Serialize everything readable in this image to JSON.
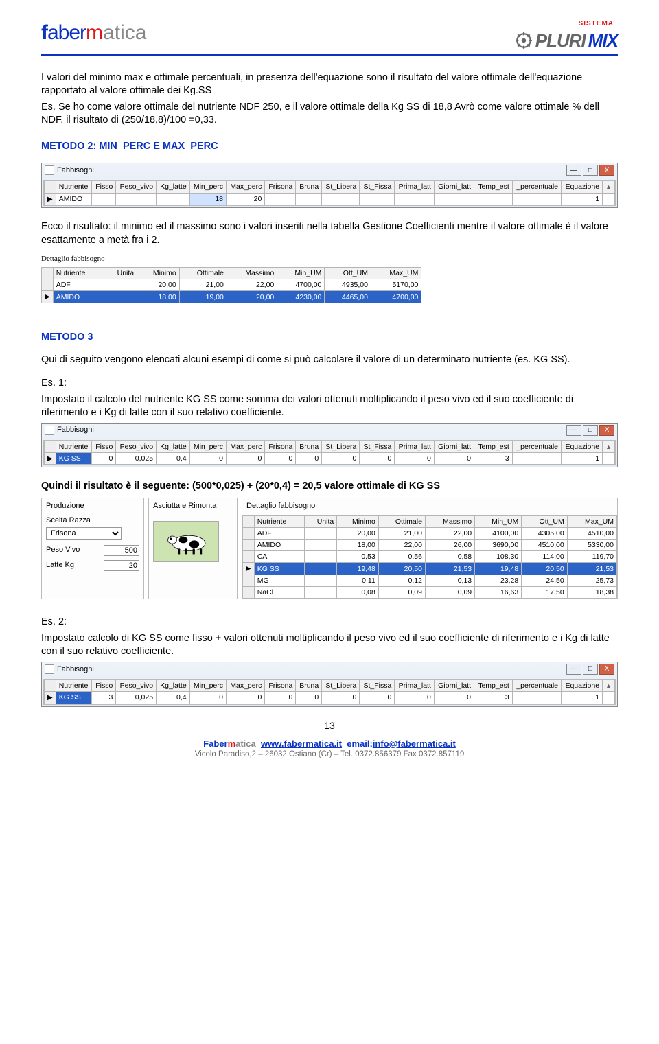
{
  "brand": {
    "left_f": "f",
    "left_aber": "aber",
    "left_m": "m",
    "left_atica": "atica",
    "right_top": "SISTEMA",
    "right_pluri": "PLURI",
    "right_mix": "MIX"
  },
  "para1_a": "I valori del minimo max e ottimale percentuali, in presenza dell'equazione sono il risultato del valore ottimale dell'equazione rapportato al valore ottimale dei Kg.SS",
  "para1_b": "Es. Se ho come valore ottimale del nutriente NDF 250, e il valore ottimale della Kg SS di 18,8 Avrò come valore ottimale % dell NDF, il risultato di (250/18,8)/100 =0,33.",
  "heading2": "METODO 2: MIN_PERC E MAX_PERC",
  "win_fabbisogni": "Fabbisogni",
  "win_btns": {
    "min": "—",
    "max": "□",
    "close": "X"
  },
  "grid1": {
    "headers": [
      "Nutriente",
      "Fisso",
      "Peso_vivo",
      "Kg_latte",
      "Min_perc",
      "Max_perc",
      "Frisona",
      "Bruna",
      "St_Libera",
      "St_Fissa",
      "Prima_latt",
      "Giorni_latt",
      "Temp_est",
      "_percentuale",
      "Equazione"
    ],
    "row": {
      "nutriente": "AMIDO",
      "min_perc": "18",
      "max_perc": "20",
      "equazione": "1"
    }
  },
  "para2": "Ecco il risultato: il minimo ed il massimo sono i valori inseriti nella tabella Gestione Coefficienti mentre il valore ottimale è il valore esattamente a metà fra i 2.",
  "dettaglio_title": "Dettaglio fabbisogno",
  "grid2": {
    "headers": [
      "Nutriente",
      "Unita",
      "Minimo",
      "Ottimale",
      "Massimo",
      "Min_UM",
      "Ott_UM",
      "Max_UM"
    ],
    "rows": [
      {
        "n": "ADF",
        "u": "",
        "min": "20,00",
        "ott": "21,00",
        "max": "22,00",
        "minu": "4700,00",
        "ottu": "4935,00",
        "maxu": "5170,00"
      },
      {
        "n": "AMIDO",
        "u": "",
        "min": "18,00",
        "ott": "19,00",
        "max": "20,00",
        "minu": "4230,00",
        "ottu": "4465,00",
        "maxu": "4700,00",
        "sel": true
      }
    ]
  },
  "heading3": "METODO 3",
  "para3": "Qui di seguito vengono elencati alcuni esempi di come si può calcolare il valore di un determinato nutriente (es. KG SS).",
  "es1_label": "Es. 1:",
  "es1_text": "Impostato il calcolo del nutriente KG SS come somma dei valori ottenuti moltiplicando il peso vivo ed il suo coefficiente di riferimento e i Kg di latte con il suo relativo coefficiente.",
  "grid3": {
    "headers": [
      "Nutriente",
      "Fisso",
      "Peso_vivo",
      "Kg_latte",
      "Min_perc",
      "Max_perc",
      "Frisona",
      "Bruna",
      "St_Libera",
      "St_Fissa",
      "Prima_latt",
      "Giorni_latt",
      "Temp_est",
      "_percentuale",
      "Equazione"
    ],
    "row": {
      "nutriente": "KG SS",
      "fisso": "0",
      "peso": "0,025",
      "kg": "0,4",
      "min": "0",
      "max": "0",
      "fri": "0",
      "bru": "0",
      "stl": "0",
      "stf": "0",
      "pri": "0",
      "gio": "0",
      "tmp": "3",
      "perc": "",
      "eq": "1"
    }
  },
  "para4": "Quindi il risultato è il seguente: (500*0,025) + (20*0,4) = 20,5 valore ottimale di KG SS",
  "prod": {
    "title_prod": "Produzione",
    "title_asc": "Asciutta e Rimonta",
    "scelta_label": "Scelta Razza",
    "scelta_value": "Frisona",
    "peso_label": "Peso Vivo",
    "peso_value": "500",
    "latte_label": "Latte Kg",
    "latte_value": "20"
  },
  "grid4": {
    "title": "Dettaglio fabbisogno",
    "headers": [
      "Nutriente",
      "Unita",
      "Minimo",
      "Ottimale",
      "Massimo",
      "Min_UM",
      "Ott_UM",
      "Max_UM"
    ],
    "rows": [
      {
        "n": "ADF",
        "u": "",
        "min": "20,00",
        "ott": "21,00",
        "max": "22,00",
        "minu": "4100,00",
        "ottu": "4305,00",
        "maxu": "4510,00"
      },
      {
        "n": "AMIDO",
        "u": "",
        "min": "18,00",
        "ott": "22,00",
        "max": "26,00",
        "minu": "3690,00",
        "ottu": "4510,00",
        "maxu": "5330,00"
      },
      {
        "n": "CA",
        "u": "",
        "min": "0,53",
        "ott": "0,56",
        "max": "0,58",
        "minu": "108,30",
        "ottu": "114,00",
        "maxu": "119,70"
      },
      {
        "n": "KG SS",
        "u": "",
        "min": "19,48",
        "ott": "20,50",
        "max": "21,53",
        "minu": "19,48",
        "ottu": "20,50",
        "maxu": "21,53",
        "sel": true
      },
      {
        "n": "MG",
        "u": "",
        "min": "0,11",
        "ott": "0,12",
        "max": "0,13",
        "minu": "23,28",
        "ottu": "24,50",
        "maxu": "25,73"
      },
      {
        "n": "NaCl",
        "u": "",
        "min": "0,08",
        "ott": "0,09",
        "max": "0,09",
        "minu": "16,63",
        "ottu": "17,50",
        "maxu": "18,38"
      }
    ]
  },
  "es2_label": "Es. 2:",
  "es2_text": "Impostato calcolo di KG SS come fisso + valori ottenuti moltiplicando il peso vivo ed il suo coefficiente di riferimento e i Kg di latte con il suo relativo coefficiente.",
  "grid5": {
    "headers": [
      "Nutriente",
      "Fisso",
      "Peso_vivo",
      "Kg_latte",
      "Min_perc",
      "Max_perc",
      "Frisona",
      "Bruna",
      "St_Libera",
      "St_Fissa",
      "Prima_latt",
      "Giorni_latt",
      "Temp_est",
      "_percentuale",
      "Equazione"
    ],
    "row": {
      "nutriente": "KG SS",
      "fisso": "3",
      "peso": "0,025",
      "kg": "0,4",
      "min": "0",
      "max": "0",
      "fri": "0",
      "bru": "0",
      "stl": "0",
      "stf": "0",
      "pri": "0",
      "gio": "0",
      "tmp": "3",
      "perc": "",
      "eq": "1"
    }
  },
  "page_number": "13",
  "footer": {
    "company_f": "Faber",
    "company_m": "m",
    "company_a": "atica",
    "site": "www.fabermatica.it",
    "email_label": "email:",
    "email": "info@fabermatica.it",
    "addr": "Vicolo Paradiso,2 – 26032 Ostiano (Cr) – Tel. 0372.856379 Fax 0372.857119"
  }
}
